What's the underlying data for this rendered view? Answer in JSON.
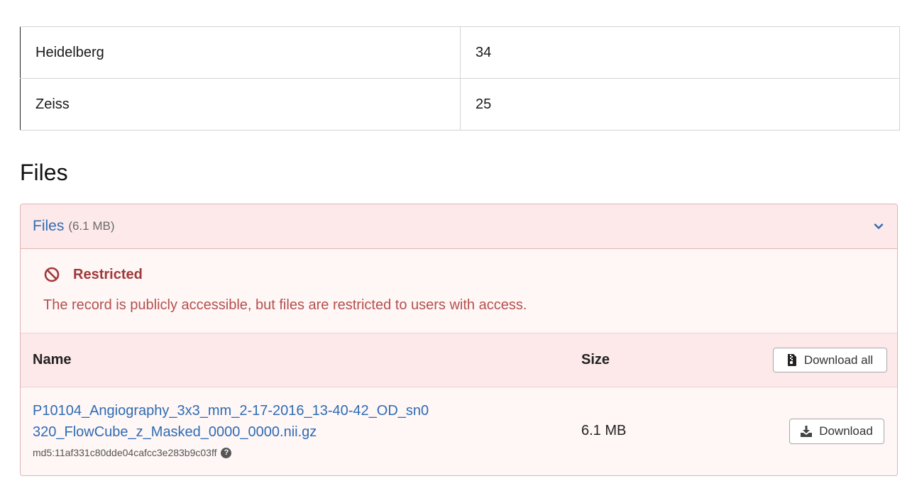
{
  "stats_table": {
    "rows": [
      {
        "label": "Heidelberg",
        "value": "34"
      },
      {
        "label": "Zeiss",
        "value": "25"
      }
    ]
  },
  "files_section": {
    "heading": "Files",
    "panel": {
      "title": "Files",
      "total_size": "(6.1 MB)",
      "chevron_icon": "chevron-down-icon"
    },
    "restricted": {
      "icon": "ban-icon",
      "title": "Restricted",
      "message": "The record is publicly accessible, but files are restricted to users with access."
    },
    "table": {
      "columns": {
        "name": "Name",
        "size": "Size"
      },
      "download_all_label": "Download all",
      "download_all_icon": "file-archive-icon",
      "files": [
        {
          "name": "P10104_Angiography_3x3_mm_2-17-2016_13-40-42_OD_sn0320_FlowCube_z_Masked_0000_0000.nii.gz",
          "md5": "md5:11af331c80dde04cafcc3e283b9c03ff",
          "size": "6.1 MB",
          "download_label": "Download",
          "download_icon": "download-icon"
        }
      ]
    }
  },
  "colors": {
    "link": "#2e6cb3",
    "restricted_title": "#9f3a38",
    "restricted_text": "#b4504d",
    "panel_bg": "#fff6f6",
    "panel_header_bg": "#fde9ea",
    "panel_border": "#e0b4b4"
  }
}
